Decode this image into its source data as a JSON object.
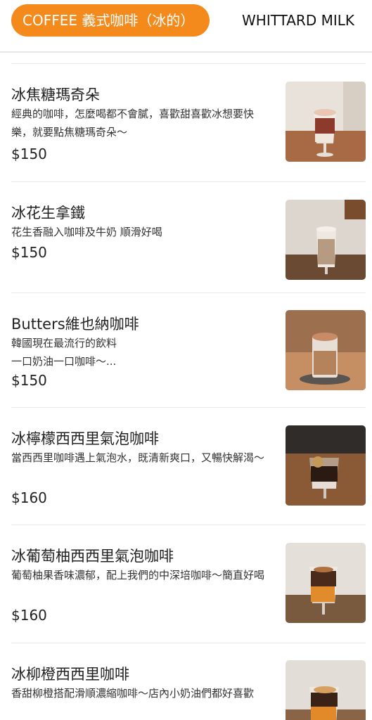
{
  "tabs": [
    {
      "label": "COFFEE 義式咖啡（冰的）"
    },
    {
      "label": "WHITTARD MILK"
    }
  ],
  "menu_items": [
    {
      "name": "冰焦糖瑪奇朵",
      "desc": "經典的咖啡，怎麼喝都不會膩，喜歡甜喜歡冰想要快樂，就要點焦糖瑪奇朵～",
      "price": "$150"
    },
    {
      "name": "冰花生拿鐵",
      "desc": "花生香融入咖啡及牛奶 順滑好喝",
      "price": "$150"
    },
    {
      "name": "Butters維也納咖啡",
      "desc_line1": "韓國現在最流行的飲料",
      "desc_line2": "一口奶油一口咖啡～...",
      "price": "$150"
    },
    {
      "name": "冰檸檬西西里氣泡咖啡",
      "desc": "當西西里咖啡遇上氣泡水，既清新爽口，又暢快解渴～",
      "price": "$160"
    },
    {
      "name": "冰葡萄柚西西里氣泡咖啡",
      "desc": "葡萄柚果香味濃郁，配上我們的中深培咖啡～簡直好喝",
      "price": "$160"
    },
    {
      "name": "冰柳橙西西里咖啡",
      "desc": "香甜柳橙搭配滑順濃縮咖啡～店內小奶油們都好喜歡",
      "price": ""
    }
  ]
}
